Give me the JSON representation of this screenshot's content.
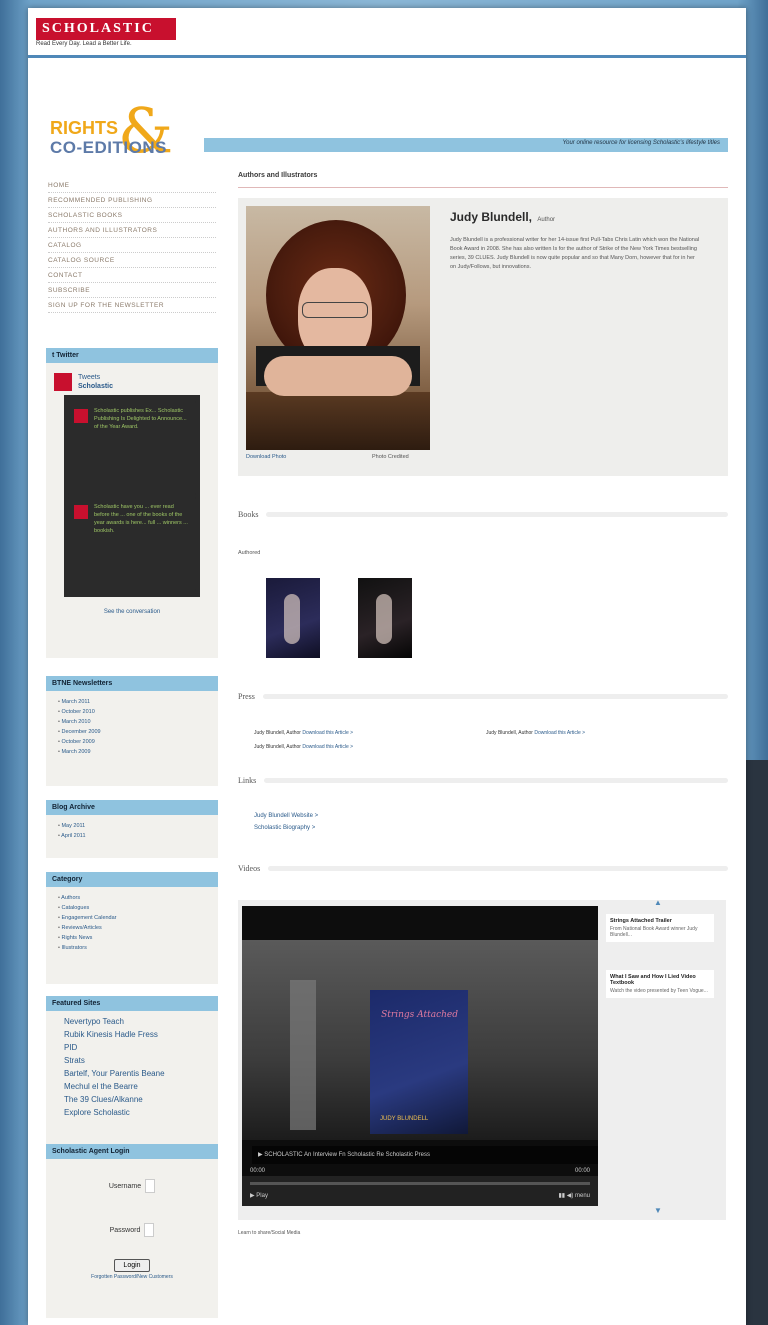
{
  "header": {
    "brand": "SCHOLASTIC",
    "brand_tagline": "Read Every Day. Lead a Better Life."
  },
  "section_logo": {
    "rights": "RIGHTS",
    "amp": "&",
    "coeditions": "CO-EDITIONS",
    "strip_text": "Your online resource for licensing Scholastic's lifestyle titles"
  },
  "nav": {
    "items": [
      "HOME",
      "RECOMMENDED PUBLISHING",
      "SCHOLASTIC BOOKS",
      "AUTHORS AND ILLUSTRATORS",
      "CATALOG",
      "CATALOG SOURCE",
      "CONTACT",
      "SUBSCRIBE",
      "SIGN UP FOR THE NEWSLETTER"
    ]
  },
  "sidebar": {
    "twitter_header": "t  Twitter",
    "twitter_account_label": "Tweets",
    "twitter_account_name": "Scholastic",
    "tweets": [
      "Scholastic publishes Ex... Scholastic Publishing Is Delighted to Announce... of the Year Award.",
      "Scholastic have you ... ever read before the ... one of the books of the year awards is here... full ... winners ... bookish."
    ],
    "tweet_more": "See the conversation",
    "newsletters_header": "BTNE Newsletters",
    "newsletters": [
      "March 2011",
      "October 2010",
      "March 2010",
      "December 2009",
      "October 2009",
      "March 2009"
    ],
    "blog_header": "Blog Archive",
    "blog": [
      "May 2011",
      "April 2011"
    ],
    "category_header": "Category",
    "categories": [
      "Authors",
      "Catalogues",
      "Engagement Calendar",
      "Reviews/Articles",
      "Rights News",
      "Illustrators"
    ],
    "featured_header": "Featured Sites",
    "featured": [
      "Nevertypo Teach",
      "Rubik Kinesis Hadle Fress",
      "PID",
      "Strats",
      "Bartelf, Your Parentis Beane",
      "Mechul el the Bearre",
      "The 39 Clues/Alkanne",
      "Explore Scholastic"
    ],
    "login_header": "Scholastic Agent Login",
    "username_label": "Username",
    "password_label": "Password",
    "login_button": "Login",
    "login_link": "Forgotten Password/New Customers"
  },
  "main": {
    "title": "Authors and Illustrators",
    "author_name": "Judy Blundell,",
    "author_role": "Author",
    "author_bio": "Judy Blundell is a professional writer for her 14-issue first Pull-Tabs Chris Latin which won the National Book Award in 2008. She has also written Is for the author of Strike of the New York Times bestselling series, 39 CLUES. Judy Blundell is now quite popular and so that Many Dorn, however that for in her on Judy/Follows, but innovations.",
    "photo_caption_left": "Download Photo",
    "photo_caption_right": "Photo Credited",
    "books_label": "Books",
    "books_sub": "Authored",
    "press_label": "Press",
    "press": [
      {
        "who": "Judy Blundell, Author",
        "link": "Download this Article >"
      },
      {
        "who": "Judy Blundell, Author",
        "link": "Download this Article >"
      },
      {
        "who": "Judy Blundell, Author",
        "link": "Download this Article >"
      }
    ],
    "links_label": "Links",
    "links": [
      "Judy Blundell Website >",
      "Scholastic Biography >"
    ],
    "videos_label": "Videos",
    "video": {
      "cover_title": "Strings Attached",
      "cover_author": "JUDY BLUNDELL",
      "bar_text": "▶ SCHOLASTIC  An Interview Fn Scholastic Re      Scholastic Press",
      "time_left": "00:00",
      "time_right": "00:00",
      "play_label": "▶ Play",
      "ctl_right": "▮▮  ◀)  menu"
    },
    "side_videos": [
      {
        "title": "Strings Attached Trailer",
        "desc": "From National Book Award winner Judy Blundell..."
      },
      {
        "title": "What I Saw and How I Lied Video Textbook",
        "desc": "Watch the video presented by Teen Vogue..."
      }
    ],
    "video_caption": "Learn to share/Social Media"
  }
}
